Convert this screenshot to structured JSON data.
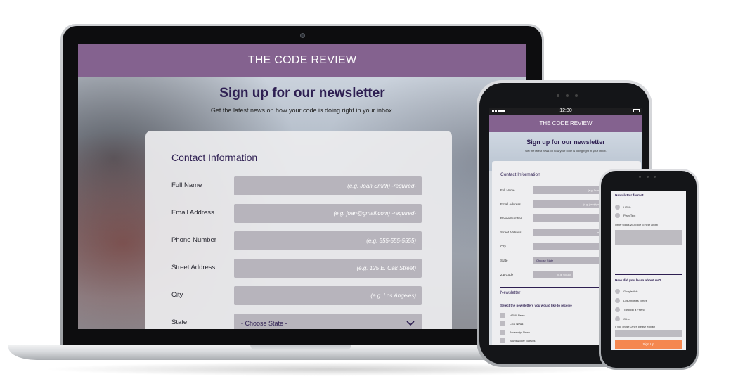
{
  "laptop": {
    "site_title": "THE CODE REVIEW",
    "hero_title": "Sign up for our newsletter",
    "hero_subtitle": "Get the latest news on how your code is doing right in your inbox.",
    "section_title": "Contact Information",
    "fields": [
      {
        "label": "Full Name",
        "placeholder": "(e.g. Joan Smith)   -required-"
      },
      {
        "label": "Email Address",
        "placeholder": "(e.g. joan@gmail.com)   -required-"
      },
      {
        "label": "Phone Number",
        "placeholder": "(e.g. 555-555-5555)"
      },
      {
        "label": "Street Address",
        "placeholder": "(e.g. 125 E. Oak Street)"
      },
      {
        "label": "City",
        "placeholder": "(e.g. Los Angeles)"
      }
    ],
    "state": {
      "label": "State",
      "value": "- Choose State -"
    }
  },
  "tablet": {
    "time": "12:30",
    "site_title": "THE CODE REVIEW",
    "hero_title": "Sign up for our newsletter",
    "hero_subtitle": "Get the latest news on how your code is doing right in your inbox.",
    "section_title": "Contact Information",
    "fields": [
      {
        "label": "Full Name",
        "placeholder": "(e.g. Joan ..."
      },
      {
        "label": "Email Address",
        "placeholder": "(e.g. joan@gm..."
      },
      {
        "label": "Phone Number",
        "placeholder": ""
      },
      {
        "label": "Street Address",
        "placeholder": "(e.g."
      },
      {
        "label": "City",
        "placeholder": ""
      }
    ],
    "state": {
      "label": "State",
      "value": "Choose State"
    },
    "zip": {
      "label": "Zip Code",
      "placeholder": "(e.g. 90036)"
    },
    "newsletter_title": "Newsletter",
    "newsletter_subtitle": "Select the newsletters you would like to receive",
    "newsletters": [
      "HTML News",
      "CSS News",
      "Javascript News",
      "Brunswicker Nuevos"
    ]
  },
  "phone": {
    "format_title": "Newsletter format",
    "formats": [
      "HTML",
      "Plain Text"
    ],
    "other_topics": "Other topics you'd like to hear about",
    "how_title": "How did you learn about us?",
    "sources": [
      "Google Ads",
      "Los Angeles Times",
      "Through a Friend",
      "Other"
    ],
    "other_note": "If you chose Other, please explain",
    "button": "Sign Up",
    "accent_color": "#f5874f"
  },
  "colors": {
    "brand": "#84628f",
    "heading": "#2e1f52",
    "field": "#b7b4bc"
  }
}
